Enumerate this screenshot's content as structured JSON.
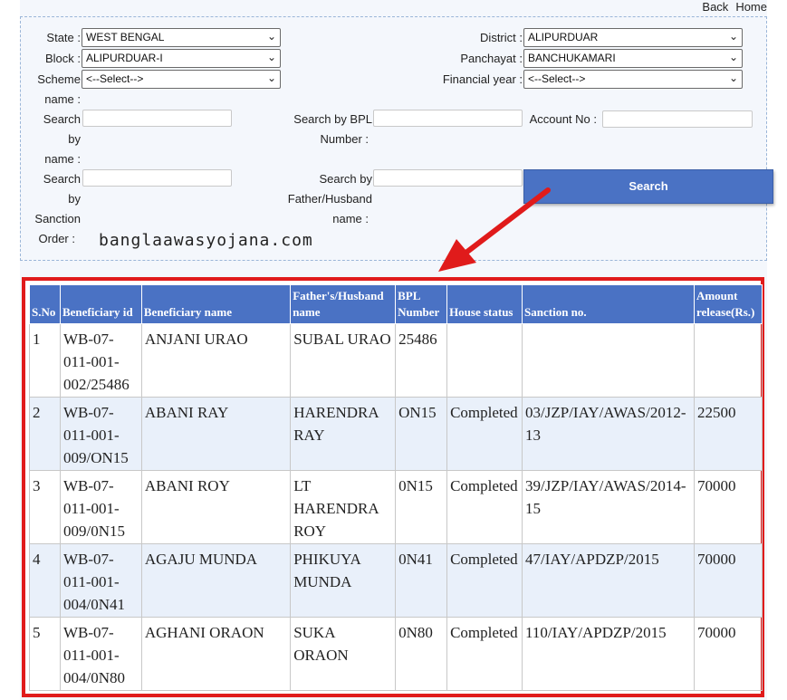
{
  "nav": {
    "back": "Back",
    "home": "Home"
  },
  "form": {
    "state_label": "State :",
    "state_value": "WEST BENGAL",
    "district_label": "District :",
    "district_value": "ALIPURDUAR",
    "block_label": "Block :",
    "block_value": "ALIPURDUAR-I",
    "panchayat_label": "Panchayat :",
    "panchayat_value": "BANCHUKAMARI",
    "scheme_label_1": "Scheme",
    "scheme_label_2": "name :",
    "scheme_value": "<--Select-->",
    "fy_label": "Financial year :",
    "fy_value": "<--Select-->",
    "search_name_label": [
      "Search",
      "by",
      "name :"
    ],
    "search_bpl_label": [
      "Search by BPL",
      "Number :"
    ],
    "account_label": "Account No :",
    "search_sanction_label": [
      "Search",
      "by",
      "Sanction",
      "Order :"
    ],
    "search_father_label": [
      "Search by",
      "Father/Husband",
      "name :"
    ],
    "search_button": "Search"
  },
  "watermark": "banglaawasyojana.com",
  "colors": {
    "header_bg": "#4a72c4",
    "highlight_border": "#e01b1b",
    "alt_row": "#e9f0fa"
  },
  "table": {
    "headers": [
      "S.No",
      "Beneficiary id",
      "Beneficiary name",
      "Father's/Husband name",
      "BPL Number",
      "House status",
      "Sanction no.",
      "Amount release(Rs.)"
    ],
    "rows": [
      [
        "1",
        "WB-07-011-001-002/25486",
        "ANJANI URAO",
        "SUBAL URAO",
        "25486",
        "",
        "",
        ""
      ],
      [
        "2",
        "WB-07-011-001-009/ON15",
        "ABANI RAY",
        "HARENDRA RAY",
        "ON15",
        "Completed",
        "03/JZP/IAY/AWAS/2012-13",
        "22500"
      ],
      [
        "3",
        "WB-07-011-001-009/0N15",
        "ABANI ROY",
        "LT HARENDRA ROY",
        "0N15",
        "Completed",
        "39/JZP/IAY/AWAS/2014-15",
        "70000"
      ],
      [
        "4",
        "WB-07-011-001-004/0N41",
        "AGAJU MUNDA",
        "PHIKUYA MUNDA",
        "0N41",
        "Completed",
        "47/IAY/APDZP/2015",
        "70000"
      ],
      [
        "5",
        "WB-07-011-001-004/0N80",
        "AGHANI ORAON",
        "SUKA ORAON",
        "0N80",
        "Completed",
        "110/IAY/APDZP/2015",
        "70000"
      ]
    ]
  }
}
